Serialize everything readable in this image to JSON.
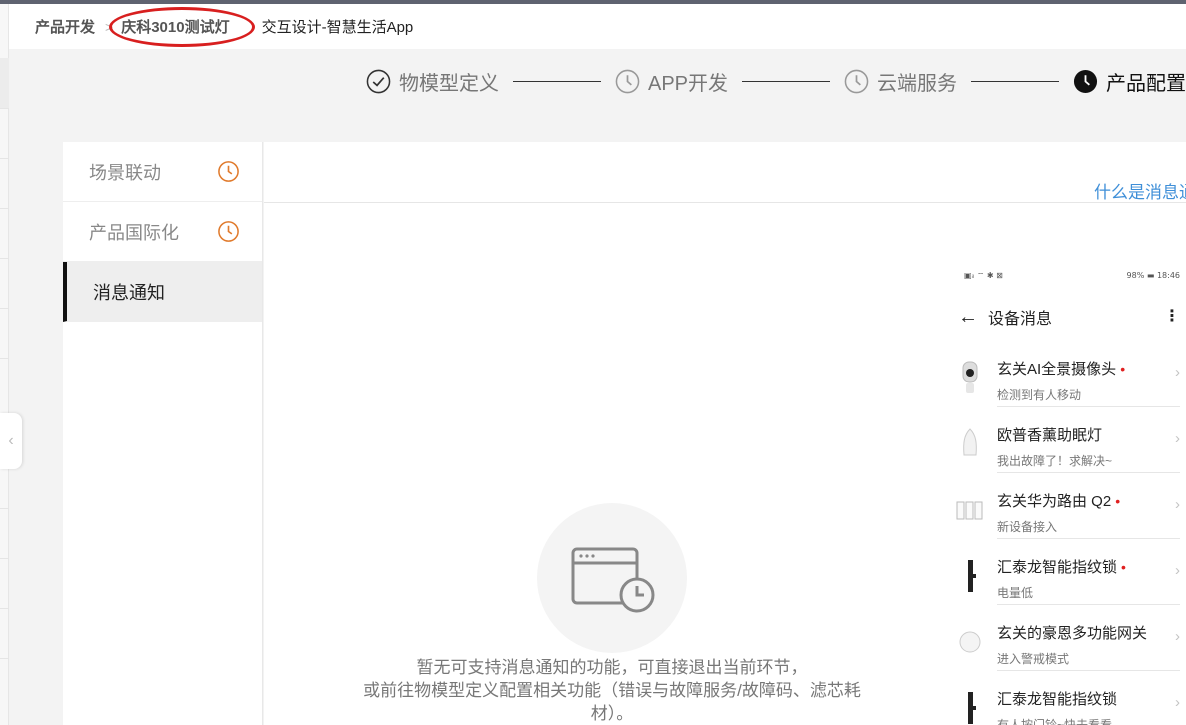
{
  "breadcrumb": {
    "root": "产品开发",
    "separator": ">",
    "product": "庆科3010测试灯",
    "current": "交互设计-智慧生活App"
  },
  "steps": [
    {
      "label": "物模型定义",
      "state": "done",
      "icon": "check-circle-icon"
    },
    {
      "label": "APP开发",
      "state": "pending",
      "icon": "clock-icon"
    },
    {
      "label": "云端服务",
      "state": "pending",
      "icon": "clock-icon"
    },
    {
      "label": "产品配置",
      "state": "active",
      "icon": "clock-filled-icon"
    }
  ],
  "sidenav": {
    "items": [
      {
        "label": "场景联动",
        "icon": "clock-icon"
      },
      {
        "label": "产品国际化",
        "icon": "clock-icon"
      },
      {
        "label": "消息通知",
        "active": true
      }
    ]
  },
  "content": {
    "help_link": "什么是消息通知",
    "empty_line1": "暂无可支持消息通知的功能，可直接退出当前环节，",
    "empty_line2": "或前往物模型定义配置相关功能（错误与故障服务/故障码、滤芯耗",
    "empty_line3": "材）。"
  },
  "phone": {
    "status_left": "▣ᵢₗ ⌔ ✱ ⊠",
    "status_right": "98% ▬ 18:46",
    "title": "设备消息",
    "back_icon": "arrow-left-icon",
    "more_icon": "more-vertical-icon",
    "devices": [
      {
        "name": "玄关AI全景摄像头",
        "sub": "检测到有人移动",
        "unread": true,
        "thumb": "camera"
      },
      {
        "name": "欧普香薰助眠灯",
        "sub": "我出故障了！求解决~",
        "unread": false,
        "thumb": "lamp"
      },
      {
        "name": "玄关华为路由 Q2",
        "sub": "新设备接入",
        "unread": true,
        "thumb": "router"
      },
      {
        "name": "汇泰龙智能指纹锁",
        "sub": "电量低",
        "unread": true,
        "thumb": "lock"
      },
      {
        "name": "玄关的豪恩多功能网关",
        "sub": "进入警戒模式",
        "unread": false,
        "thumb": "gateway"
      },
      {
        "name": "汇泰龙智能指纹锁",
        "sub": "有人按门铃~快去看看",
        "unread": false,
        "thumb": "lock"
      }
    ],
    "unread_dot": "•",
    "chevron": "›"
  },
  "colors": {
    "accent_orange": "#e07a2c",
    "link_blue": "#3f8fd8",
    "annotation_red": "#d81f1f"
  }
}
